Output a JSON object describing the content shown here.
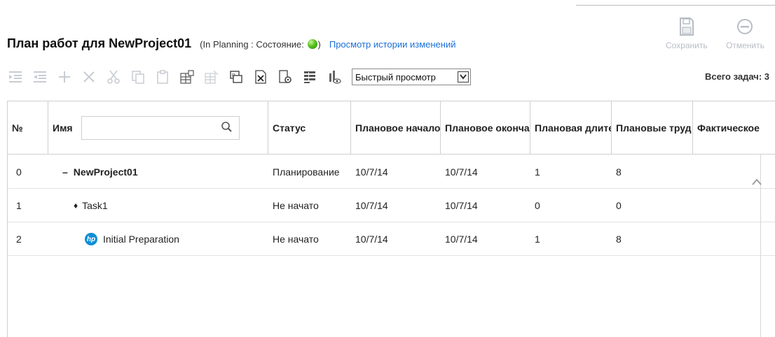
{
  "header": {
    "title": "План работ для NewProject01",
    "meta_prefix": "(In Planning : Состояние:",
    "meta_suffix": ")",
    "status_color": "#58c21c",
    "history_link": "Просмотр истории изменений"
  },
  "actions": {
    "save_label": "Сохранить",
    "cancel_label": "Отменить"
  },
  "toolbar": {
    "icons": [
      "indent-icon",
      "outdent-icon",
      "add-icon",
      "delete-icon",
      "cut-icon",
      "copy-icon",
      "paste-icon",
      "insert-child-icon",
      "insert-template-icon",
      "project-icon",
      "excel-export-icon",
      "settings-icon",
      "columns-icon",
      "view-icon"
    ],
    "quickview_value": "Быстрый просмотр",
    "total_label": "Всего задач: 3"
  },
  "table": {
    "columns": {
      "num": "№",
      "name": "Имя",
      "status": "Статус",
      "plan_start": "Плановое начало",
      "plan_end": "Плановое оконча",
      "plan_duration": "Плановая длите",
      "plan_effort": "Плановые труд",
      "actual": "Фактическое"
    },
    "rows": [
      {
        "num": "0",
        "prefix": "–",
        "name": "NewProject01",
        "status": "Планирование",
        "plan_start": "10/7/14",
        "plan_end": "10/7/14",
        "plan_duration": "1",
        "plan_effort": "8"
      },
      {
        "num": "1",
        "prefix": "♦",
        "name": "Task1",
        "status": "Не начато",
        "plan_start": "10/7/14",
        "plan_end": "10/7/14",
        "plan_duration": "0",
        "plan_effort": "0"
      },
      {
        "num": "2",
        "prefix": "hp",
        "name": "Initial Preparation",
        "status": "Не начато",
        "plan_start": "10/7/14",
        "plan_end": "10/7/14",
        "plan_duration": "1",
        "plan_effort": "8"
      }
    ]
  }
}
